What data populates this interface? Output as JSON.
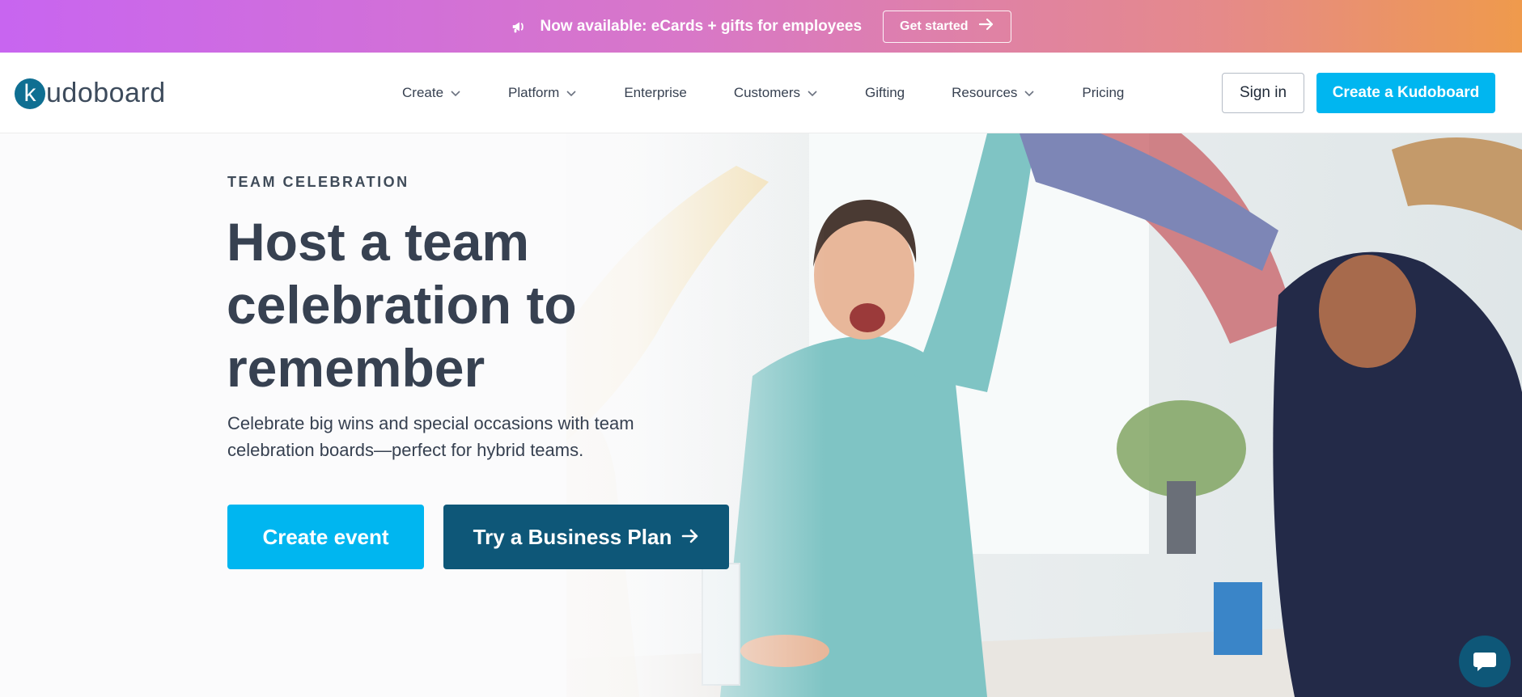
{
  "announcement": {
    "icon": "megaphone-icon",
    "message": "Now available: eCards + gifts for employees",
    "cta_label": "Get started"
  },
  "brand": {
    "logo_letter": "k",
    "logo_rest": "udoboard",
    "accent": "#00b6f0",
    "dark": "#0e5778"
  },
  "nav": {
    "items": [
      {
        "label": "Create",
        "has_dropdown": true
      },
      {
        "label": "Platform",
        "has_dropdown": true
      },
      {
        "label": "Enterprise",
        "has_dropdown": false
      },
      {
        "label": "Customers",
        "has_dropdown": true
      },
      {
        "label": "Gifting",
        "has_dropdown": false
      },
      {
        "label": "Resources",
        "has_dropdown": true
      },
      {
        "label": "Pricing",
        "has_dropdown": false
      }
    ],
    "sign_in": "Sign in",
    "create_cta": "Create a Kudoboard"
  },
  "hero": {
    "eyebrow": "TEAM CELEBRATION",
    "headline": "Host a team celebration to remember",
    "subtext": "Celebrate big wins and special occasions with team celebration boards—perfect for hybrid teams.",
    "primary_cta": "Create event",
    "secondary_cta": "Try a Business Plan",
    "secondary_icon": "arrow-right-icon"
  },
  "chat": {
    "icon": "chat-bubble-icon"
  }
}
